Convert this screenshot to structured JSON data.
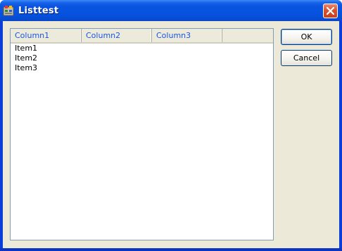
{
  "window": {
    "title": "Listtest"
  },
  "listview": {
    "columns": [
      "Column1",
      "Column2",
      "Column3"
    ],
    "items": [
      {
        "label": "Item1"
      },
      {
        "label": "Item2"
      },
      {
        "label": "Item3"
      }
    ]
  },
  "buttons": {
    "ok": "OK",
    "cancel": "Cancel"
  },
  "colors": {
    "titlebar": "#0054e3",
    "client": "#ece9d8",
    "header_text": "#1c55e8",
    "close_button": "#d8532f"
  },
  "icons": {
    "app": "app-icon",
    "close": "close-icon"
  }
}
